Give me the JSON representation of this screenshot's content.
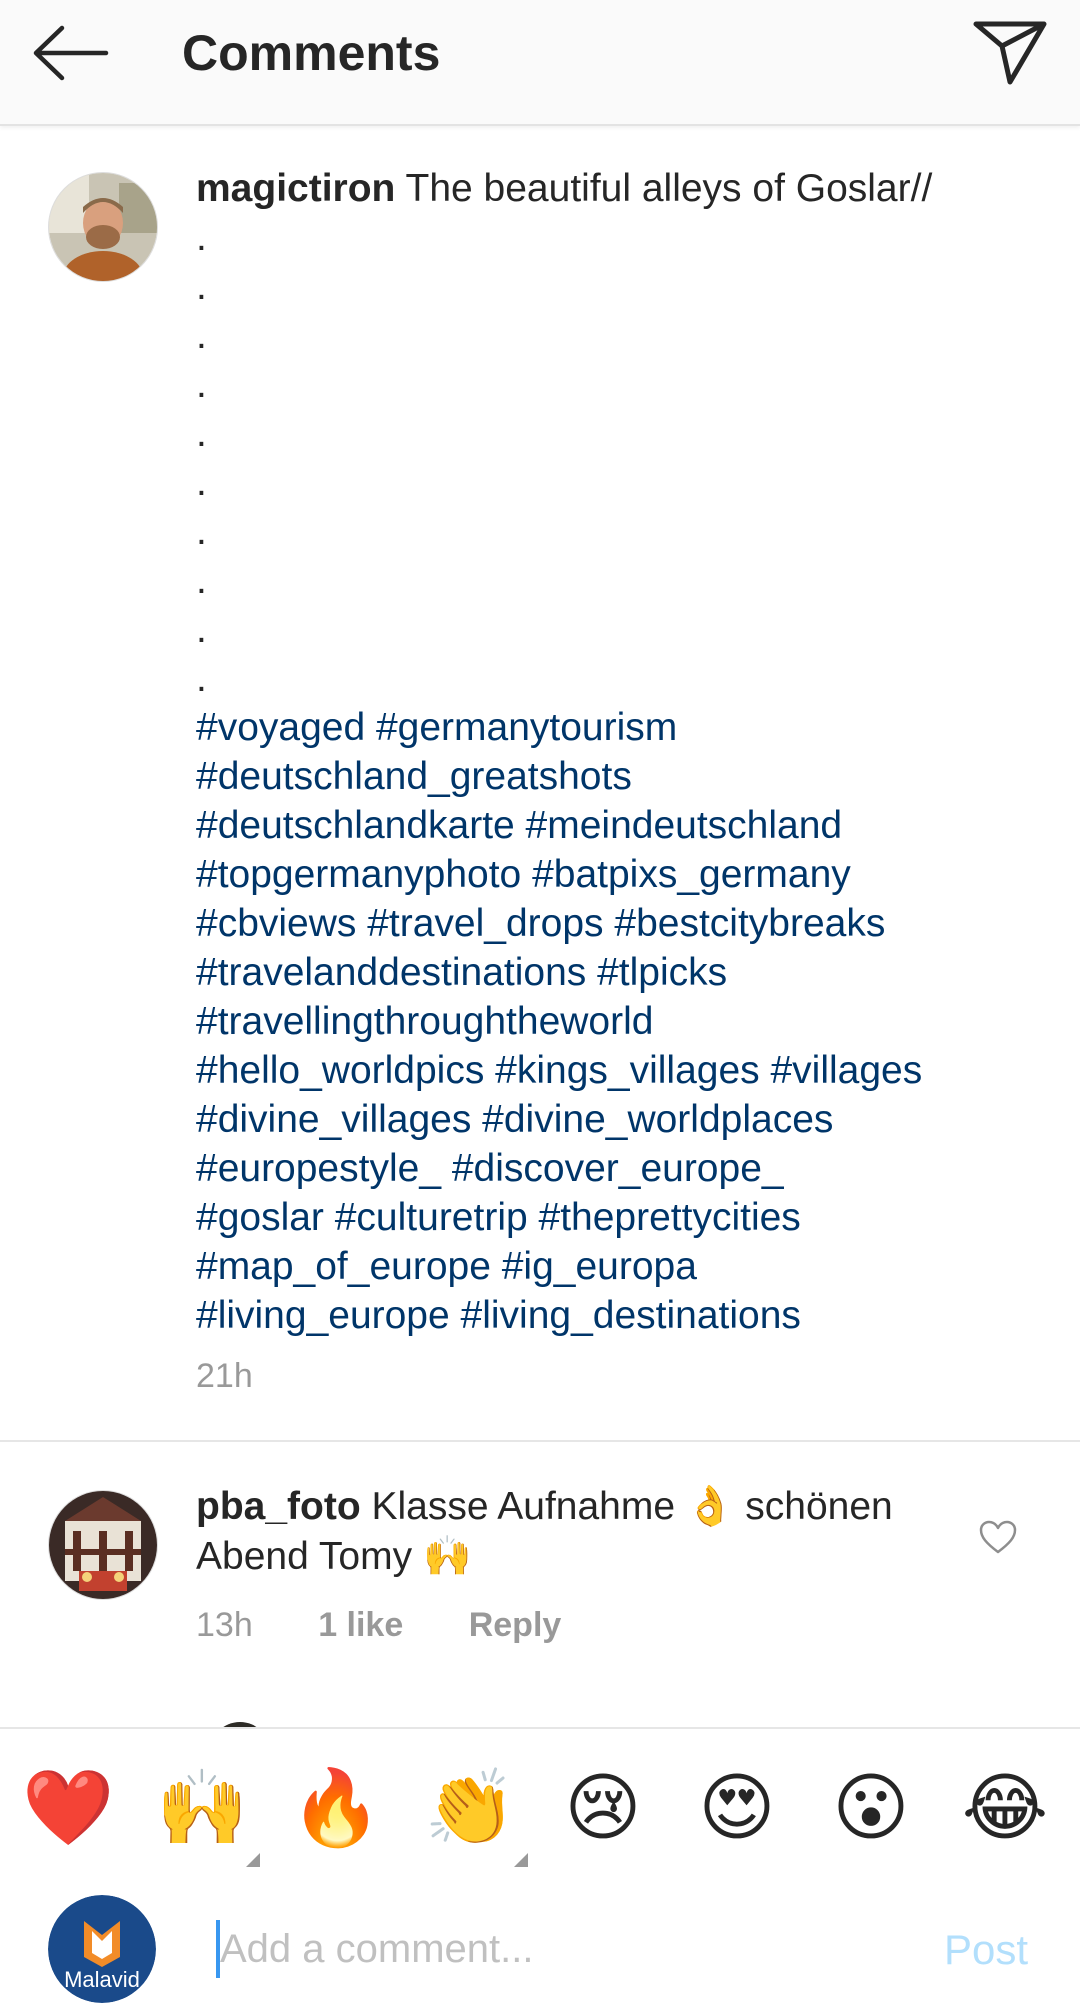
{
  "header": {
    "title": "Comments"
  },
  "caption": {
    "username": "magictiron",
    "text": "The beautiful alleys of Goslar//",
    "dots": [
      ".",
      ".",
      ".",
      ".",
      ".",
      ".",
      ".",
      ".",
      ".",
      "."
    ],
    "hashtag_lines": [
      "#voyaged #germanytourism",
      "#deutschland_greatshots",
      "#deutschlandkarte #meindeutschland",
      "#topgermanyphoto #batpixs_germany",
      "#cbviews #travel_drops #bestcitybreaks",
      "#travelanddestinations #tlpicks",
      "#travellingthroughtheworld",
      "#hello_worldpics #kings_villages #villages",
      "#divine_villages #divine_worldplaces",
      "#europestyle_ #discover_europe_",
      "#goslar #culturetrip #theprettycities",
      "#map_of_europe #ig_europa",
      "#living_europe #living_destinations"
    ],
    "time": "21h"
  },
  "comment": {
    "username": "pba_foto",
    "text_part1": "Klasse Aufnahme",
    "emoji1": "👌",
    "text_part2": "schönen",
    "text_line2": "Abend Tomy",
    "emoji2": "🙌",
    "time": "13h",
    "likes": "1 like",
    "reply": "Reply"
  },
  "emoji_bar": [
    "❤️",
    "🙌",
    "🔥",
    "👏",
    "😢",
    "😍",
    "😮",
    "😂"
  ],
  "input": {
    "placeholder": "Add a comment...",
    "post_label": "Post",
    "avatar_text": "Malavid"
  },
  "colors": {
    "hashtag": "#003569",
    "meta": "#999999",
    "post_disabled": "#b2dffc"
  }
}
